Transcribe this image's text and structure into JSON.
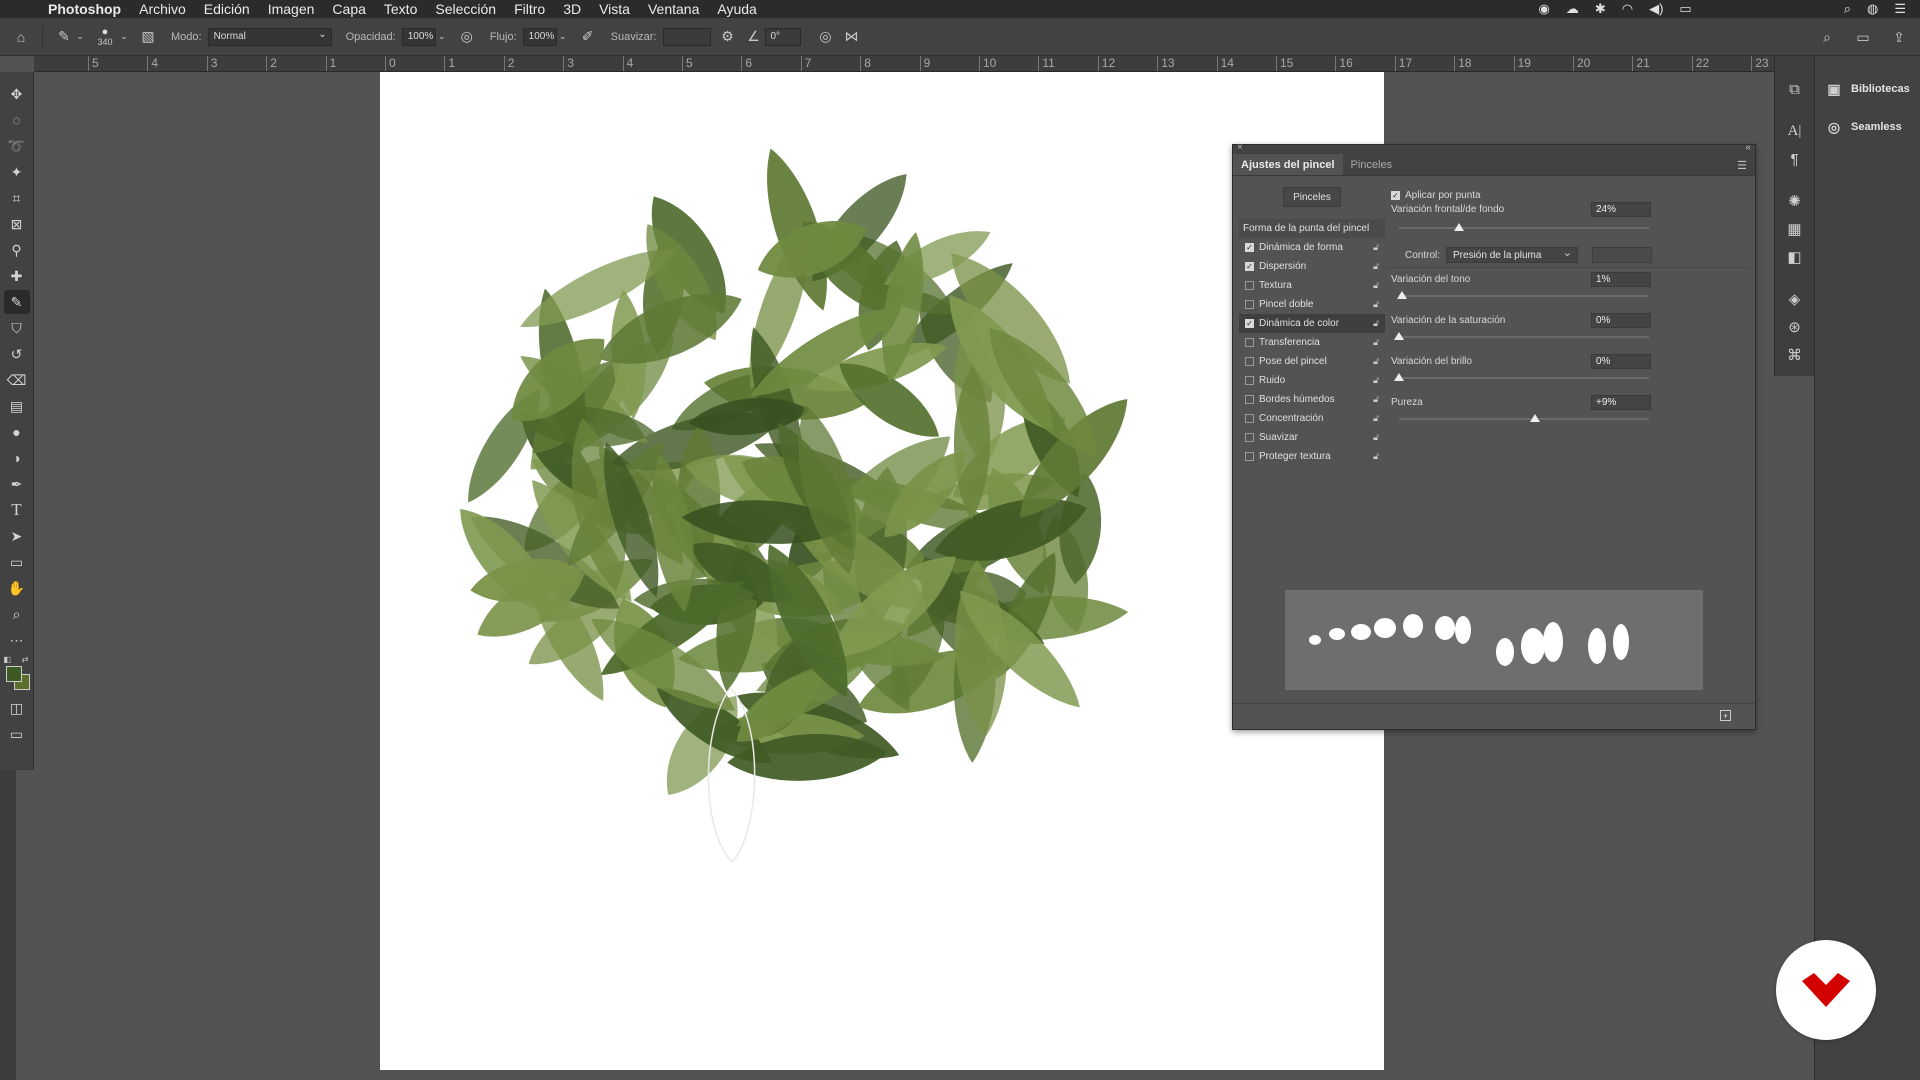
{
  "menubar": {
    "apple_icon": "apple-icon",
    "app_name": "Photoshop",
    "items": [
      "Archivo",
      "Edición",
      "Imagen",
      "Capa",
      "Texto",
      "Selección",
      "Filtro",
      "3D",
      "Vista",
      "Ventana",
      "Ayuda"
    ]
  },
  "options_bar": {
    "brush_size": "340",
    "mode_label": "Modo:",
    "mode_value": "Normal",
    "opacity_label": "Opacidad:",
    "opacity_value": "100%",
    "flow_label": "Flujo:",
    "flow_value": "100%",
    "smoothing_label": "Suavizar:",
    "smoothing_value": "",
    "angle_value": "0°"
  },
  "ruler_top": [
    "5",
    "4",
    "3",
    "2",
    "1",
    "0",
    "1",
    "2",
    "3",
    "4",
    "5",
    "6",
    "7",
    "8",
    "9",
    "10",
    "11",
    "12",
    "13",
    "14",
    "15",
    "16",
    "17",
    "18",
    "19",
    "20",
    "21",
    "22",
    "23"
  ],
  "dock_panels": {
    "libraries": "Bibliotecas",
    "seamless": "Seamless"
  },
  "brush_panel": {
    "tab_active": "Ajustes del pincel",
    "tab_other": "Pinceles",
    "brushes_button": "Pinceles",
    "tip_shape": "Forma de la punta del pincel",
    "options": [
      {
        "label": "Dinámica de forma",
        "checked": true
      },
      {
        "label": "Dispersión",
        "checked": true
      },
      {
        "label": "Textura",
        "checked": false
      },
      {
        "label": "Pincel doble",
        "checked": false
      },
      {
        "label": "Dinámica de color",
        "checked": true
      },
      {
        "label": "Transferencia",
        "checked": false
      },
      {
        "label": "Pose del pincel",
        "checked": false
      },
      {
        "label": "Ruido",
        "checked": false
      },
      {
        "label": "Bordes húmedos",
        "checked": false
      },
      {
        "label": "Concentración",
        "checked": false
      },
      {
        "label": "Suavizar",
        "checked": false
      },
      {
        "label": "Proteger textura",
        "checked": false
      }
    ],
    "apply_per_tip": "Aplicar por punta",
    "fg_bg_jitter": {
      "label": "Variación frontal/de fondo",
      "value": "24%",
      "level": 0.24
    },
    "control_label": "Control:",
    "control_value": "Presión de la pluma",
    "hue_jitter": {
      "label": "Variación del tono",
      "value": "1%",
      "level": 0.01
    },
    "saturation_jitter": {
      "label": "Variación de la saturación",
      "value": "0%",
      "level": 0.0
    },
    "brightness_jitter": {
      "label": "Variación del brillo",
      "value": "0%",
      "level": 0.0
    },
    "purity": {
      "label": "Pureza",
      "value": "+9%",
      "level": 0.545
    }
  },
  "colors": {
    "foreground": "#3d5a25",
    "background": "#5b6e2b",
    "logo_red": "#d40000"
  }
}
